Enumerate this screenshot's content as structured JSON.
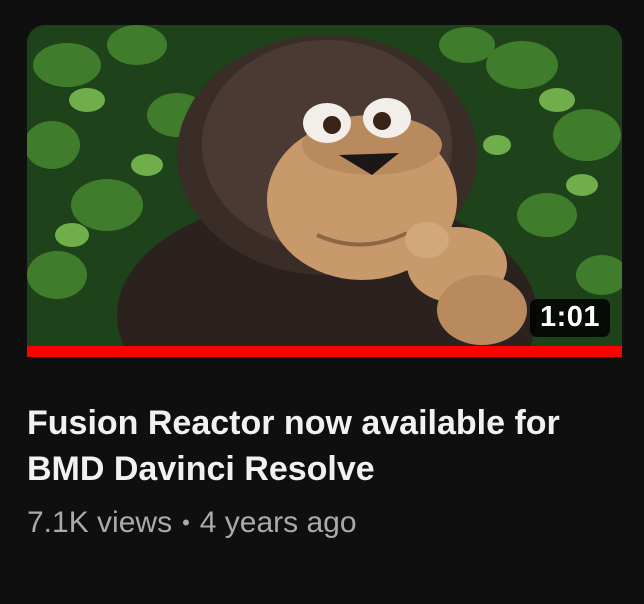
{
  "video": {
    "duration": "1:01",
    "watch_progress": 1.0,
    "title": "Fusion Reactor now available for BMD Davinci Resolve",
    "views": "7.1K views",
    "separator": "•",
    "age": "4 years ago",
    "thumbnail_subject": "brown monkey puppet pointing in front of ivy leaves"
  },
  "colors": {
    "background": "#0f0f0f",
    "progress": "#ff0000",
    "title": "#f1f1f1",
    "meta": "#aaaaaa"
  }
}
